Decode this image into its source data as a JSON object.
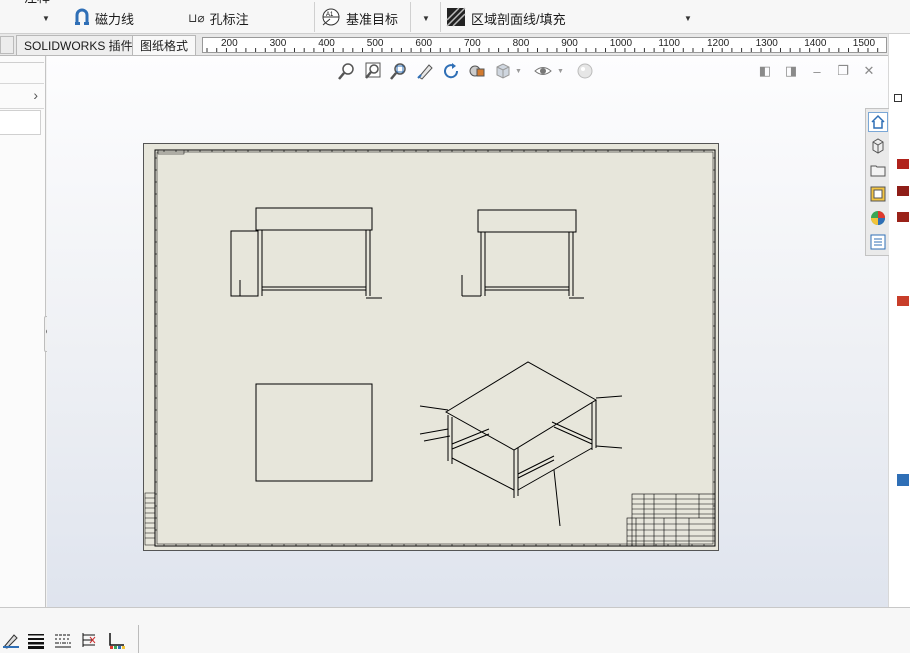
{
  "toolbar": {
    "top_cut_text": "注释",
    "magnetic_line": "磁力线",
    "hole_callout": "孔标注",
    "datum_target": "基准目标",
    "area_hatch": "区域剖面线/填充"
  },
  "tabs": {
    "solidworks_addins": "SOLIDWORKS 插件",
    "sheet_format": "图纸格式"
  },
  "ruler": {
    "labels": [
      "200",
      "300",
      "400",
      "500",
      "600",
      "700",
      "800",
      "900",
      "1000",
      "1100",
      "1200",
      "1300",
      "1400",
      "1500"
    ]
  },
  "heads_up_toolbar": {
    "icons": [
      "zoom-to-fit-icon",
      "zoom-area-icon",
      "zoom-selection-icon",
      "sketch-pen-icon",
      "rotate-icon",
      "modify-view-icon",
      "display-style-icon",
      "hide-show-icon",
      "appearance-icon"
    ]
  },
  "task_pane": {
    "icons": [
      "home-icon",
      "parts-library-icon",
      "file-explorer-icon",
      "view-palette-icon",
      "appearances-icon",
      "custom-properties-icon"
    ]
  },
  "colors": {
    "sheet_background": "#e7e6db",
    "drawing_lines": "#000000",
    "viewport_top": "#fdfdfe",
    "viewport_bottom": "#dfe4ee",
    "accent_blue": "#2f6fb6"
  }
}
